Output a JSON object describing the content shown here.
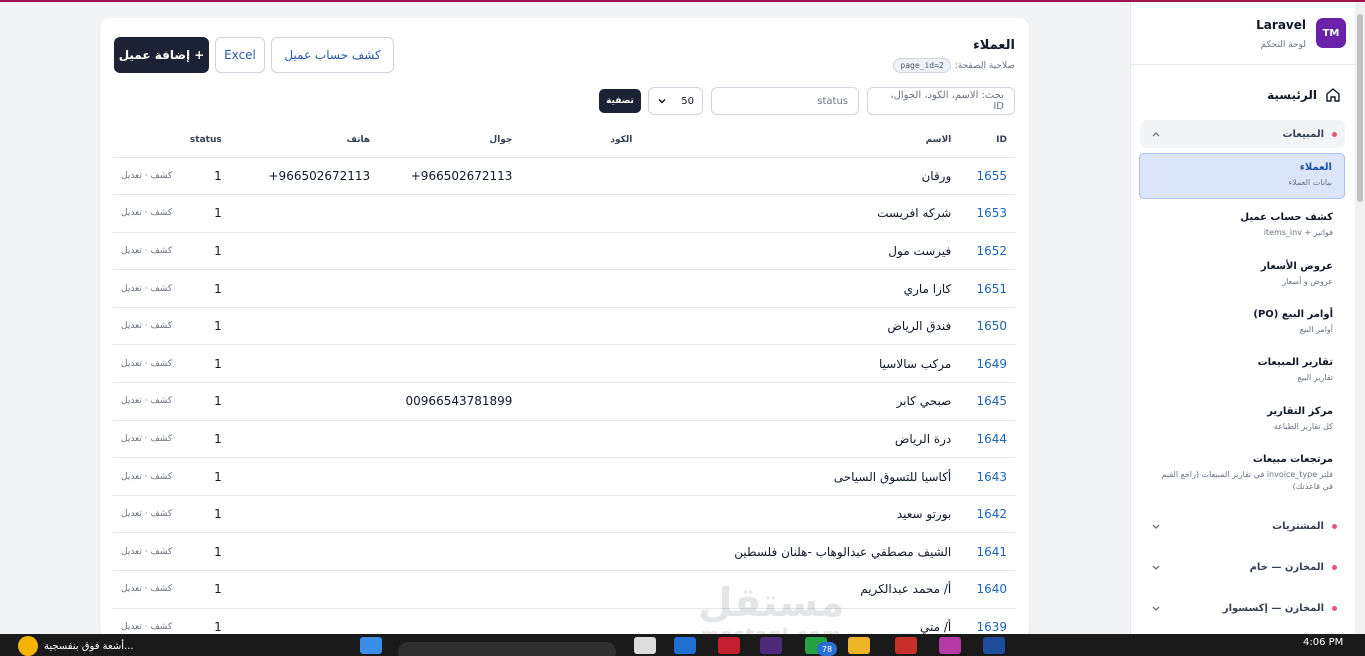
{
  "sidebar": {
    "brand": {
      "logo_text": "TM",
      "name": "Laravel",
      "subtitle": "لوحة التحكم"
    },
    "home_label": "الرئيسية",
    "sections": [
      {
        "label": "المبيعات",
        "open": true
      },
      {
        "label": "المشتريات",
        "open": false
      },
      {
        "label": "المخازن — خام",
        "open": false
      },
      {
        "label": "المخازن — إكسسوار",
        "open": false
      }
    ],
    "items": [
      {
        "title": "العملاء",
        "subtitle": "بيانات العملاء",
        "active": true
      },
      {
        "title": "كشف حساب عميل",
        "subtitle": "فواتير + items_inv"
      },
      {
        "title": "عروض الأسعار",
        "subtitle": "عروض و أسعار"
      },
      {
        "title": "أوامر البيع (PO)",
        "subtitle": "أوامر البيع"
      },
      {
        "title": "تقارير المبيعات",
        "subtitle": "تقارير البيع"
      },
      {
        "title": "مركز التقارير",
        "subtitle": "كل تقارير الطباعة"
      },
      {
        "title": "مرتجعات مبيعات",
        "subtitle": "فلتر invoice_type في تقارير المبيعات (راجع القيم في قاعدتك)"
      }
    ]
  },
  "header": {
    "title": "العملاء",
    "permission_label": "صلاحية الصفحة:",
    "permission_badge": "page_id=2",
    "add_button": "+ إضافة عميل",
    "excel_button": "Excel",
    "statement_button": "كشف حساب عميل"
  },
  "filters": {
    "search_placeholder": "بحث: الاسم، الكود، الجوال، ID",
    "status_placeholder": "status",
    "per_page": "50",
    "filter_button": "تصفية"
  },
  "table": {
    "columns": {
      "id": "ID",
      "name": "الاسم",
      "code": "الكود",
      "mobile": "جوال",
      "phone": "هاتف",
      "status": "status"
    },
    "action_text": "كشف · تعديل",
    "rows": [
      {
        "id": "1655",
        "name": "ورقان",
        "code": "",
        "mobile": "+966502672113",
        "phone": "+966502672113",
        "status": "1"
      },
      {
        "id": "1653",
        "name": "شركه افريست",
        "code": "",
        "mobile": "",
        "phone": "",
        "status": "1"
      },
      {
        "id": "1652",
        "name": "فيرست مول",
        "code": "",
        "mobile": "",
        "phone": "",
        "status": "1"
      },
      {
        "id": "1651",
        "name": "كازا ماري",
        "code": "",
        "mobile": "",
        "phone": "",
        "status": "1"
      },
      {
        "id": "1650",
        "name": "فندق الرياض",
        "code": "",
        "mobile": "",
        "phone": "",
        "status": "1"
      },
      {
        "id": "1649",
        "name": "مركب سالاسيا",
        "code": "",
        "mobile": "",
        "phone": "",
        "status": "1"
      },
      {
        "id": "1645",
        "name": "صبحي كابر",
        "code": "",
        "mobile": "00966543781899",
        "phone": "",
        "status": "1"
      },
      {
        "id": "1644",
        "name": "درة الرياض",
        "code": "",
        "mobile": "",
        "phone": "",
        "status": "1"
      },
      {
        "id": "1643",
        "name": "أكاسيا للتسوق السياحى",
        "code": "",
        "mobile": "",
        "phone": "",
        "status": "1"
      },
      {
        "id": "1642",
        "name": "بورتو سعيد",
        "code": "",
        "mobile": "",
        "phone": "",
        "status": "1"
      },
      {
        "id": "1641",
        "name": "الشيف مصطفي عبدالوهاب -هلنان فلسطين",
        "code": "",
        "mobile": "",
        "phone": "",
        "status": "1"
      },
      {
        "id": "1640",
        "name": "أ/ محمد عبدالكريم",
        "code": "",
        "mobile": "",
        "phone": "",
        "status": "1"
      },
      {
        "id": "1639",
        "name": "أ/ متي",
        "code": "",
        "mobile": "",
        "phone": "",
        "status": "1"
      }
    ]
  },
  "watermark": {
    "arabic": "مستقل",
    "latin": "mostaql.com"
  },
  "taskbar": {
    "weather_text": "أشعة فوق بنفسجية...",
    "notification_count": "78",
    "time": "4:06 PM"
  },
  "colors": {
    "primary": "#1b2235",
    "link": "#1e63b8",
    "accent_top": "#a0144f",
    "brand_logo": "#6b21a8"
  }
}
